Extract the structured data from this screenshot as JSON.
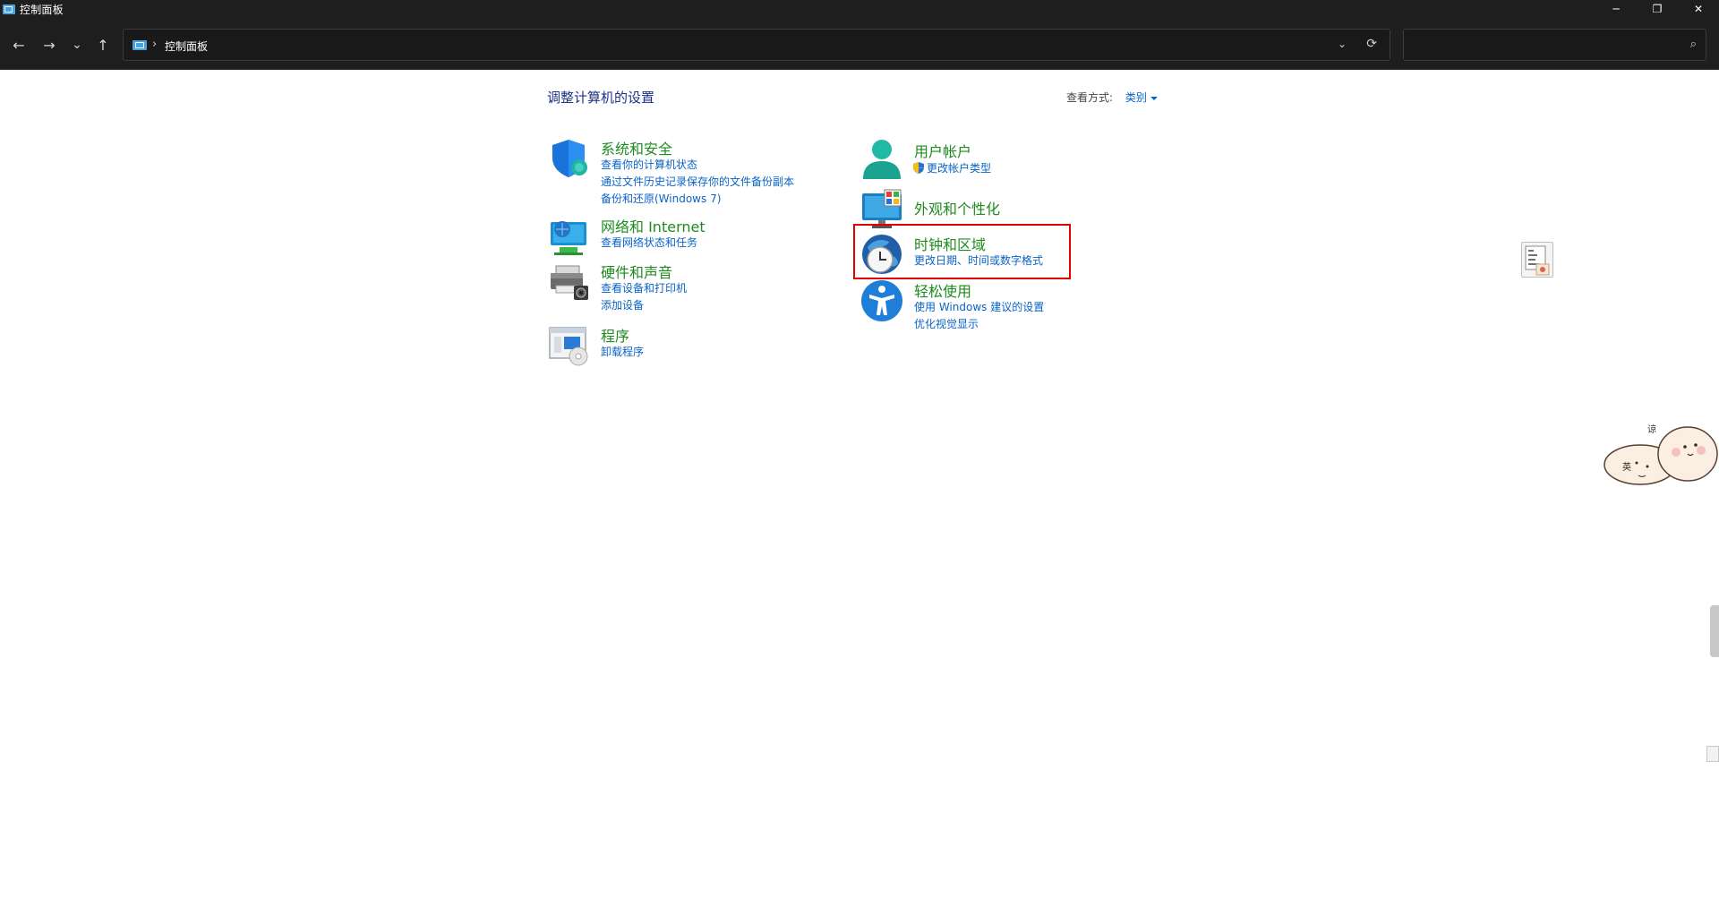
{
  "window": {
    "title": "控制面板",
    "minimize_glyph": "─",
    "maximize_glyph": "❐",
    "close_glyph": "✕"
  },
  "nav": {
    "back_glyph": "←",
    "forward_glyph": "→",
    "recent_glyph": "⌄",
    "up_glyph": "↑",
    "breadcrumb_sep": "›",
    "breadcrumb": "控制面板",
    "address_dropdown_glyph": "⌄",
    "refresh_glyph": "⟳",
    "search_placeholder": "",
    "search_glyph": "⌕"
  },
  "content": {
    "page_title": "调整计算机的设置",
    "view_by_label": "查看方式:",
    "view_by_value": "类别",
    "left_categories": [
      {
        "icon": "shield-icon",
        "title": "系统和安全",
        "links": [
          "查看你的计算机状态",
          "通过文件历史记录保存你的文件备份副本",
          "备份和还原(Windows 7)"
        ]
      },
      {
        "icon": "network-icon",
        "title": "网络和 Internet",
        "links": [
          "查看网络状态和任务"
        ]
      },
      {
        "icon": "printer-icon",
        "title": "硬件和声音",
        "links": [
          "查看设备和打印机",
          "添加设备"
        ]
      },
      {
        "icon": "programs-icon",
        "title": "程序",
        "links": [
          "卸载程序"
        ]
      }
    ],
    "right_categories": [
      {
        "icon": "user-icon",
        "title": "用户帐户",
        "links": [
          "更改帐户类型"
        ]
      },
      {
        "icon": "appearance-icon",
        "title": "外观和个性化",
        "links": []
      },
      {
        "icon": "clock-globe-icon",
        "title": "时钟和区域",
        "links": [
          "更改日期、时间或数字格式"
        ]
      },
      {
        "icon": "accessibility-icon",
        "title": "轻松使用",
        "links": [
          "使用 Windows 建议的设置",
          "优化视觉显示"
        ]
      }
    ]
  },
  "overlay": {
    "mascot_label_1": "英",
    "mascot_label_2": "谅",
    "highlight_color": "#e00000"
  },
  "colors": {
    "title_bar": "#1e1e1e",
    "category_title": "#1f8a1f",
    "link": "#0a63c8",
    "page_title": "#1e3287"
  }
}
